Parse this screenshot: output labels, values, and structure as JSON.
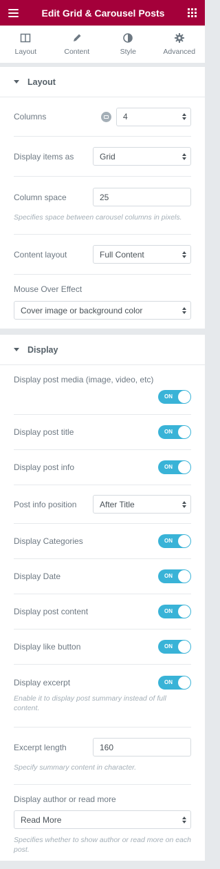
{
  "header": {
    "title": "Edit Grid & Carousel Posts",
    "menu_icon": "hamburger-icon",
    "apps_icon": "grid-icon"
  },
  "tabs": [
    {
      "label": "Layout",
      "icon": "columns-icon",
      "active": true
    },
    {
      "label": "Content",
      "icon": "pencil-icon",
      "active": false
    },
    {
      "label": "Style",
      "icon": "half-circle-icon",
      "active": false
    },
    {
      "label": "Advanced",
      "icon": "gear-icon",
      "active": false
    }
  ],
  "layout_section": {
    "title": "Layout",
    "columns": {
      "label": "Columns",
      "value": "4"
    },
    "display_items_as": {
      "label": "Display items as",
      "value": "Grid"
    },
    "column_space": {
      "label": "Column space",
      "value": "25",
      "description": "Specifies space between carousel columns in pixels."
    },
    "content_layout": {
      "label": "Content layout",
      "value": "Full Content"
    },
    "mouse_over_effect": {
      "label": "Mouse Over Effect",
      "value": "Cover image or background color"
    }
  },
  "display_section": {
    "title": "Display",
    "toggle_on_text": "ON",
    "accent_color": "#39b3d7",
    "post_media": {
      "label": "Display post media (image, video, etc)",
      "on": true
    },
    "post_title": {
      "label": "Display post title",
      "on": true
    },
    "post_info": {
      "label": "Display post info",
      "on": true
    },
    "post_info_position": {
      "label": "Post info position",
      "value": "After Title"
    },
    "categories": {
      "label": "Display Categories",
      "on": true
    },
    "date": {
      "label": "Display Date",
      "on": true
    },
    "post_content": {
      "label": "Display post content",
      "on": true
    },
    "like_button": {
      "label": "Display like button",
      "on": true
    },
    "excerpt": {
      "label": "Display excerpt",
      "on": true,
      "description": "Enable it to display post summary instead of full content."
    },
    "excerpt_length": {
      "label": "Excerpt length",
      "value": "160",
      "description": "Specify summary content in character."
    },
    "author_or_read_more": {
      "label": "Display author or read more",
      "value": "Read More",
      "description": "Specifies whether to show author or read more on each post."
    }
  }
}
